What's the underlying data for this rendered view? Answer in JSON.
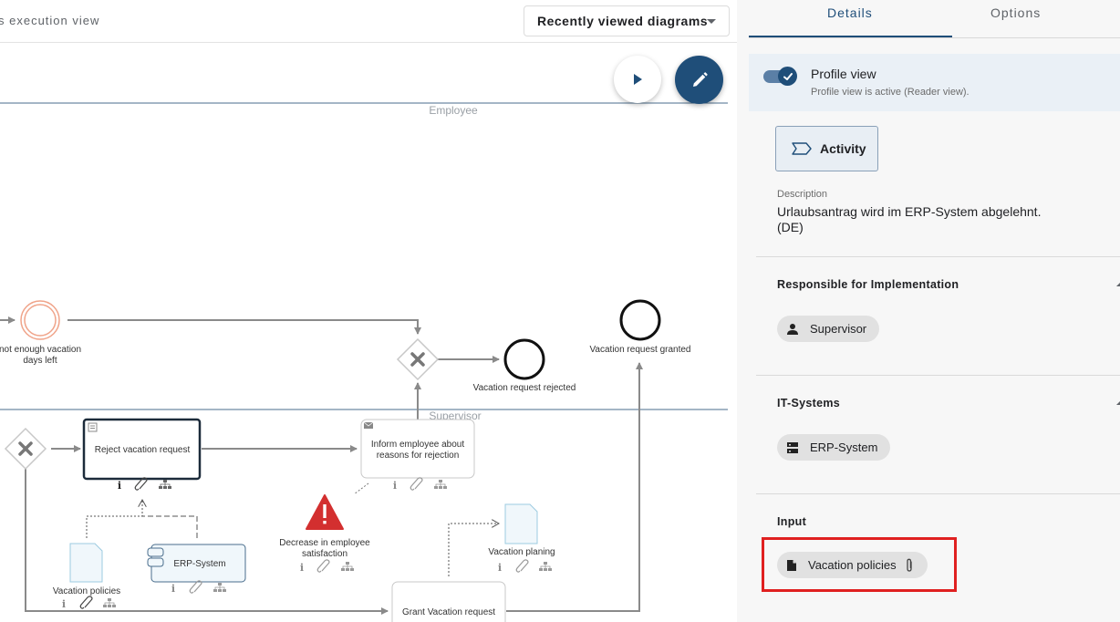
{
  "toolbar": {
    "view_title": "s execution view",
    "recent_dropdown_label": "Recently viewed diagrams"
  },
  "diagram": {
    "lanes": [
      "Employee",
      "Supervisor"
    ],
    "labels": {
      "not_enough_1": "not enough vacation",
      "not_enough_2": "days left",
      "rejected": "Vacation request rejected",
      "granted": "Vacation request granted",
      "reject_task": "Reject vacation request",
      "inform_1": "Inform employee about",
      "inform_2": "reasons for rejection",
      "decrease_1": "Decrease in employee",
      "decrease_2": "satisfaction",
      "vacation_policies": "Vacation policies",
      "erp_system": "ERP-System",
      "vacation_planing": "Vacation planing",
      "grant_task": "Grant Vacation request"
    }
  },
  "panel": {
    "tabs": [
      "Details",
      "Options"
    ],
    "profile_title": "Profile view",
    "profile_subtitle": "Profile view is active (Reader view).",
    "type_label": "Activity",
    "description_label": "Description",
    "description_line1": "Urlaubsantrag wird im ERP-System abgelehnt.",
    "description_line2": "(DE)",
    "sections": [
      {
        "title": "Responsible for Implementation",
        "chip": "Supervisor",
        "icon": "person-icon"
      },
      {
        "title": "IT-Systems",
        "chip": "ERP-System",
        "icon": "server-icon"
      },
      {
        "title": "Input",
        "chip": "Vacation policies",
        "icon": "document-icon"
      }
    ]
  },
  "colors": {
    "accent": "#1f4e79",
    "highlight": "#e02020",
    "panel_bg": "#f7f7f7",
    "profile_bg": "#eaf0f6",
    "warning": "#d32f2f"
  }
}
